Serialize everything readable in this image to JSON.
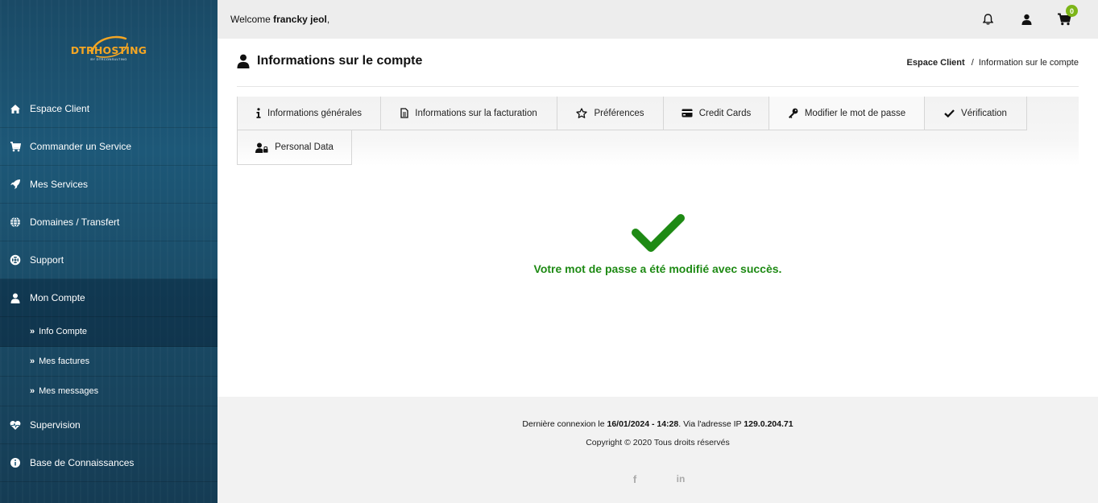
{
  "brand": {
    "logo_text": "DTRHOSTING",
    "logo_sub": "BY DTRCONSULTING",
    "accent": "#f5a623"
  },
  "sidebar": {
    "items": [
      {
        "label": "Espace Client",
        "icon": "home-icon"
      },
      {
        "label": "Commander un Service",
        "icon": "cart-icon"
      },
      {
        "label": "Mes Services",
        "icon": "rocket-icon"
      },
      {
        "label": "Domaines / Transfert",
        "icon": "globe-icon"
      },
      {
        "label": "Support",
        "icon": "lifebuoy-icon"
      },
      {
        "label": "Mon Compte",
        "icon": "user-icon"
      }
    ],
    "subitems": [
      {
        "label": "Info Compte"
      },
      {
        "label": "Mes factures"
      },
      {
        "label": "Mes messages"
      }
    ],
    "bottom_items": [
      {
        "label": "Supervision",
        "icon": "heartbeat-icon"
      },
      {
        "label": "Base de Connaissances",
        "icon": "info-circle-icon"
      }
    ]
  },
  "topbar": {
    "welcome_prefix": "Welcome",
    "user_name": "francky jeol",
    "welcome_suffix": ",",
    "cart_count": "0"
  },
  "page": {
    "title": "Informations sur le compte",
    "breadcrumb_root": "Espace Client",
    "breadcrumb_sep": "/",
    "breadcrumb_current": "Information sur le compte"
  },
  "tabs": [
    {
      "label": "Informations générales",
      "icon": "info-icon"
    },
    {
      "label": "Informations sur la facturation",
      "icon": "file-icon"
    },
    {
      "label": "Préférences",
      "icon": "star-icon"
    },
    {
      "label": "Credit Cards",
      "icon": "credit-card-icon"
    },
    {
      "label": "Modifier le mot de passe",
      "icon": "key-icon"
    },
    {
      "label": "Vérification",
      "icon": "check-icon"
    },
    {
      "label": "Personal Data",
      "icon": "user-lock-icon"
    }
  ],
  "success": {
    "message": "Votre mot de passe a été modifié avec succès.",
    "color": "#1e8a14"
  },
  "footer": {
    "last_login_prefix": "Dernière connexion le",
    "last_login_date": "16/01/2024 - 14:28",
    "last_login_mid": ". Via l'adresse IP",
    "ip": "129.0.204.71",
    "copyright": "Copyright © 2020 Tous droits réservés",
    "facebook": "f",
    "linkedin": "in"
  }
}
